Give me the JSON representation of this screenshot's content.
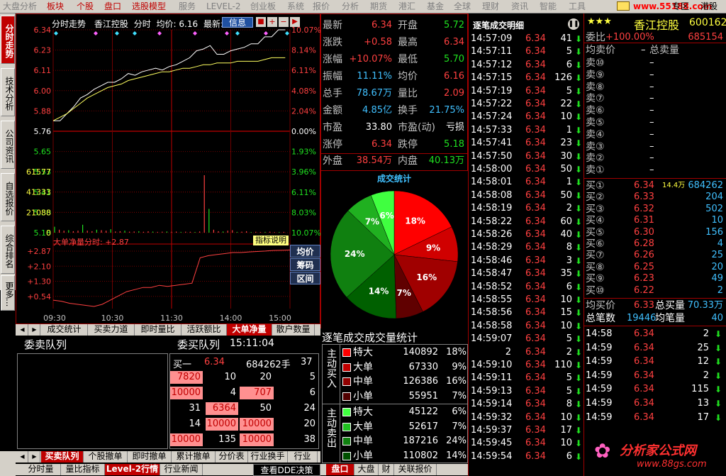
{
  "menu": {
    "items": [
      {
        "label": "大盘分析",
        "style": "off"
      },
      {
        "label": "板块",
        "style": "on"
      },
      {
        "label": "个股",
        "style": "on"
      },
      {
        "label": "盘口",
        "style": "on"
      },
      {
        "label": "选股模型",
        "style": "on"
      },
      {
        "label": "服务",
        "style": "off"
      },
      {
        "label": "LEVEL-2",
        "style": "off"
      },
      {
        "label": "创业板",
        "style": "off"
      },
      {
        "label": "系统",
        "style": "off"
      },
      {
        "label": "报价",
        "style": "off"
      },
      {
        "label": "分析",
        "style": "off"
      },
      {
        "label": "期货",
        "style": "off"
      },
      {
        "label": "港汇",
        "style": "off"
      },
      {
        "label": "基金",
        "style": "off"
      },
      {
        "label": "全球",
        "style": "off"
      },
      {
        "label": "理财",
        "style": "off"
      },
      {
        "label": "资讯",
        "style": "off"
      },
      {
        "label": "智能",
        "style": "off"
      },
      {
        "label": "工具",
        "style": "off"
      }
    ],
    "watermark": "www.55188.com",
    "zone_label": "专区",
    "hk_label": "港股"
  },
  "left_tabs": [
    "分时走势",
    "技术分析",
    "公司资讯",
    "自选报价",
    "综合排名",
    "更多..."
  ],
  "chart_header": {
    "title": "分时走势",
    "stock": "香江控股",
    "mode": "分时",
    "avg_label": "均价: 6.16",
    "latest_label": "最新: 6",
    "btn_info": "信息"
  },
  "chart_data": [
    {
      "type": "line",
      "title": "分时走势",
      "x_ticks": [
        "09:30",
        "10:30",
        "11:30",
        "14:00",
        "15:00"
      ],
      "y_left_ticks": [
        "6.34",
        "6.23",
        "6.11",
        "6.00",
        "5.88",
        "5.76",
        "5.65",
        "5.53",
        "5.41",
        "5.30",
        "5.18"
      ],
      "y_right_ticks": [
        "10.07%",
        "8.14%",
        "6.11%",
        "4.08%",
        "2.04%",
        "0.00%",
        "1.93%",
        "3.96%",
        "6.11%",
        "8.03%",
        "10.07%"
      ],
      "ylim": [
        5.18,
        6.34
      ],
      "series": [
        {
          "name": "价格",
          "values": [
            5.82,
            5.82,
            5.86,
            5.9,
            5.95,
            5.97,
            6.0,
            6.02,
            6.04,
            6.04,
            6.06,
            6.09,
            6.08,
            6.1,
            6.11,
            6.12,
            6.11,
            6.13,
            6.14,
            6.16,
            6.18,
            6.22,
            6.23,
            6.25,
            6.2,
            6.2,
            6.22,
            6.23,
            6.24,
            6.26,
            6.26,
            6.3,
            6.3,
            6.34,
            6.34
          ]
        },
        {
          "name": "均价",
          "values": [
            5.82,
            5.84,
            5.86,
            5.89,
            5.92,
            5.95,
            5.97,
            5.99,
            6.01,
            6.02,
            6.03,
            6.05,
            6.06,
            6.07,
            6.08,
            6.09,
            6.1,
            6.1,
            6.11,
            6.12,
            6.12,
            6.13,
            6.14,
            6.14,
            6.15,
            6.15,
            6.15,
            6.16,
            6.16,
            6.16,
            6.16,
            6.17,
            6.18,
            6.18,
            6.18
          ]
        }
      ]
    },
    {
      "type": "bar",
      "title": "成交量",
      "y_ticks": [
        "61577",
        "41333",
        "21088",
        "0"
      ],
      "ylim": [
        0,
        61577
      ],
      "values": [
        6000,
        3000,
        2000,
        2500,
        1500,
        2000,
        8000,
        2000,
        1500,
        3000,
        2500,
        2000,
        3500,
        1200,
        1500,
        2000,
        1000,
        1200,
        1500,
        900,
        1400,
        1100,
        800,
        1000,
        1200,
        900,
        1100,
        800,
        1000,
        900,
        700,
        1200,
        58000,
        24000,
        3000,
        1500,
        1200,
        2000,
        2500,
        800,
        1000,
        1500,
        700,
        900,
        600,
        800,
        1000,
        600,
        700,
        800
      ]
    },
    {
      "type": "area",
      "title": "大单净量分时",
      "series": [
        {
          "name": "大单净量",
          "values": [
            0.5,
            0.45,
            0.35,
            0.3,
            0.25,
            0.2,
            0.3,
            0.5,
            0.7,
            0.9,
            1.0,
            1.1,
            1.1,
            1.2,
            1.15,
            1.2,
            1.25,
            1.3,
            2.5,
            2.6,
            2.65,
            2.7,
            2.75,
            2.75,
            2.78,
            2.8,
            2.82,
            2.85,
            2.86,
            2.87
          ]
        }
      ],
      "y_ticks": [
        "+2.87",
        "+2.10",
        "+1.30",
        "+0.54"
      ],
      "ylim": [
        0.1,
        2.95
      ]
    },
    {
      "type": "pie",
      "title": "成交统计",
      "labels": [
        "18%",
        "9%",
        "16%",
        "7%",
        "14%",
        "24%",
        "7%",
        "6%"
      ],
      "values": [
        18,
        9,
        16,
        7,
        14,
        24,
        7,
        6
      ],
      "colors": [
        "#ff0000",
        "#d00000",
        "#a00000",
        "#600000",
        "#006000",
        "#108010",
        "#20b020",
        "#40ff40"
      ]
    }
  ],
  "netflow": {
    "label": "大单净量分时: +2.87",
    "help": "指标说明"
  },
  "side_buttons": [
    "均价",
    "筹码",
    "区间"
  ],
  "lower_tabs": [
    "成交统计",
    "买卖力道",
    "即时量比",
    "活跃额比",
    "大单净量",
    "散户数量"
  ],
  "queue": {
    "title_left": "委卖队列",
    "title_mid": "委买队列",
    "time": "15:11:04",
    "buy1_label": "买一",
    "buy1_price": "6.34",
    "buy1_vol": "684262手",
    "buy1_extra": "37",
    "rows": [
      [
        "7820",
        "10",
        "20",
        "5"
      ],
      [
        "10000",
        "4",
        "707",
        "6"
      ],
      [
        "31",
        "6364",
        "50",
        "24"
      ],
      [
        "14",
        "10000",
        "10000",
        "20"
      ],
      [
        "10000",
        "135",
        "10000",
        "38"
      ]
    ]
  },
  "bottom_tabs1": [
    "买卖队列",
    "个股撤单",
    "即时撤单",
    "累计撤单",
    "分价表",
    "行业换手",
    "行业"
  ],
  "bottom_tabs2": [
    "分时量",
    "量比指标",
    "Level-2行情",
    "行业新闻"
  ],
  "dde_btn": "查看DDE决策",
  "bottom_tabs3": [
    "盘口",
    "大盘",
    "财",
    "关联报价"
  ],
  "quote": [
    {
      "l": "最新",
      "v": "6.34",
      "vc": "red",
      "l2": "开盘",
      "v2": "5.72",
      "v2c": "green"
    },
    {
      "l": "涨跌",
      "v": "+0.58",
      "vc": "red",
      "l2": "最高",
      "v2": "6.34",
      "v2c": "red"
    },
    {
      "l": "涨幅",
      "v": "+10.07%",
      "vc": "red",
      "l2": "最低",
      "v2": "5.70",
      "v2c": "green"
    },
    {
      "l": "振幅",
      "v": "11.11%",
      "vc": "cyan",
      "l2": "均价",
      "v2": "6.16",
      "v2c": "red"
    },
    {
      "l": "总手",
      "v": "78.67万",
      "vc": "cyan",
      "l2": "量比",
      "v2": "2.09",
      "v2c": "red"
    },
    {
      "l": "金额",
      "v": "4.85亿",
      "vc": "cyan",
      "l2": "换手",
      "v2": "21.75%",
      "v2c": "cyan"
    },
    {
      "l": "市盈",
      "v": "33.80",
      "vc": "white",
      "l2": "市盈(动)",
      "v2": "亏损",
      "v2c": "white"
    },
    {
      "l": "涨停",
      "v": "6.34",
      "vc": "red",
      "l2": "跌停",
      "v2": "5.18",
      "v2c": "green"
    },
    {
      "l": "外盘",
      "v": "38.54万",
      "vc": "red",
      "l2": "内盘",
      "v2": "40.13万",
      "v2c": "green"
    }
  ],
  "pie_title": "成交统计",
  "stats": {
    "title": "逐笔成交成交量统计",
    "buy_label": "主动买入",
    "sell_label": "主动卖出",
    "buy": [
      {
        "name": "特大",
        "vol": "140892",
        "pct": "18%",
        "color": "#ff0000"
      },
      {
        "name": "大单",
        "vol": "67330",
        "pct": "9%",
        "color": "#c00000"
      },
      {
        "name": "中单",
        "vol": "126386",
        "pct": "16%",
        "color": "#900000"
      },
      {
        "name": "小单",
        "vol": "55951",
        "pct": "7%",
        "color": "#500000"
      }
    ],
    "sell": [
      {
        "name": "特大",
        "vol": "45122",
        "pct": "6%",
        "color": "#40ff40"
      },
      {
        "name": "大单",
        "vol": "52617",
        "pct": "7%",
        "color": "#20c020"
      },
      {
        "name": "中单",
        "vol": "187216",
        "pct": "24%",
        "color": "#108010"
      },
      {
        "name": "小单",
        "vol": "110802",
        "pct": "14%",
        "color": "#005000"
      }
    ]
  },
  "ticks_title": "逐笔成交明细",
  "ticks": [
    [
      "14:57:09",
      "6.34",
      "41",
      "up"
    ],
    [
      "14:57:11",
      "6.34",
      "5",
      "up"
    ],
    [
      "14:57:12",
      "6.34",
      "6",
      "up"
    ],
    [
      "14:57:15",
      "6.34",
      "126",
      "up"
    ],
    [
      "14:57:19",
      "6.34",
      "5",
      "up"
    ],
    [
      "14:57:22",
      "6.34",
      "22",
      "up"
    ],
    [
      "14:57:24",
      "6.34",
      "10",
      "up"
    ],
    [
      "14:57:33",
      "6.34",
      "1",
      "up"
    ],
    [
      "14:57:41",
      "6.34",
      "23",
      "up"
    ],
    [
      "14:57:50",
      "6.34",
      "30",
      "up"
    ],
    [
      "14:58:00",
      "6.34",
      "50",
      "up"
    ],
    [
      "14:58:01",
      "6.34",
      "1",
      "up"
    ],
    [
      "14:58:08",
      "6.34",
      "50",
      "up"
    ],
    [
      "14:58:19",
      "6.34",
      "2",
      "up"
    ],
    [
      "14:58:22",
      "6.34",
      "60",
      "up"
    ],
    [
      "14:58:26",
      "6.34",
      "40",
      "up"
    ],
    [
      "14:58:29",
      "6.34",
      "8",
      "up"
    ],
    [
      "14:58:46",
      "6.34",
      "3",
      "up"
    ],
    [
      "14:58:47",
      "6.34",
      "35",
      "up"
    ],
    [
      "14:58:52",
      "6.34",
      "6",
      "up"
    ],
    [
      "14:58:55",
      "6.34",
      "10",
      "up"
    ],
    [
      "14:58:56",
      "6.34",
      "15",
      "up"
    ],
    [
      "14:58:58",
      "6.34",
      "10",
      "up"
    ],
    [
      "14:59:07",
      "6.34",
      "5",
      "up"
    ],
    [
      "2",
      "6.34",
      "2",
      "up"
    ],
    [
      "14:59:10",
      "6.34",
      "110",
      "up"
    ],
    [
      "14:59:11",
      "6.34",
      "5",
      "up"
    ],
    [
      "14:59:13",
      "6.34",
      "5",
      "up"
    ],
    [
      "14:59:14",
      "6.34",
      "8",
      "up"
    ],
    [
      "14:59:32",
      "6.34",
      "10",
      "up"
    ],
    [
      "14:59:37",
      "6.34",
      "17",
      "up"
    ],
    [
      "14:59:45",
      "6.34",
      "10",
      "up"
    ],
    [
      "14:59:54",
      "6.34",
      "6",
      "up"
    ]
  ],
  "book": {
    "name": "香江控股",
    "code": "600162",
    "stars": "★★★",
    "weibi_label": "委比",
    "weibi": "+100.00%",
    "weicha": "685154",
    "avg_sell_label": "均卖价",
    "total_sell_label": "总卖量",
    "avg_sell": "–",
    "sell": [
      [
        "卖⑩",
        "–",
        ""
      ],
      [
        "卖⑨",
        "–",
        ""
      ],
      [
        "卖⑧",
        "–",
        ""
      ],
      [
        "卖⑦",
        "–",
        ""
      ],
      [
        "卖⑥",
        "–",
        ""
      ],
      [
        "卖⑤",
        "–",
        ""
      ],
      [
        "卖④",
        "–",
        ""
      ],
      [
        "卖③",
        "–",
        ""
      ],
      [
        "卖②",
        "–",
        ""
      ],
      [
        "卖①",
        "–",
        ""
      ]
    ],
    "buy": [
      [
        "买①",
        "6.34",
        "684262",
        "14.4万"
      ],
      [
        "买②",
        "6.33",
        "204",
        ""
      ],
      [
        "买③",
        "6.32",
        "502",
        ""
      ],
      [
        "买④",
        "6.31",
        "10",
        ""
      ],
      [
        "买⑤",
        "6.30",
        "156",
        ""
      ],
      [
        "买⑥",
        "6.28",
        "4",
        ""
      ],
      [
        "买⑦",
        "6.26",
        "25",
        ""
      ],
      [
        "买⑧",
        "6.25",
        "20",
        ""
      ],
      [
        "买⑨",
        "6.23",
        "49",
        ""
      ],
      [
        "买⑩",
        "6.22",
        "2",
        ""
      ]
    ],
    "avg_buy_label": "均买价",
    "avg_buy": "6.33",
    "total_buy_label": "总买量",
    "total_buy": "70.33万",
    "count_label": "总笔数",
    "count": "19446",
    "avg_vol_label": "均笔量",
    "avg_vol": "40",
    "minute_ticks": [
      [
        "14:58",
        "6.34",
        "2"
      ],
      [
        "14:59",
        "6.34",
        "25"
      ],
      [
        "14:59",
        "6.34",
        "12"
      ],
      [
        "14:59",
        "6.34",
        "2"
      ],
      [
        "14:59",
        "6.34",
        "115"
      ],
      [
        "14:59",
        "6.34",
        "13"
      ],
      [
        "14:59",
        "6.34",
        "17"
      ]
    ]
  },
  "logo": {
    "text": "分析家公式网",
    "url": "www.88gs.com"
  }
}
